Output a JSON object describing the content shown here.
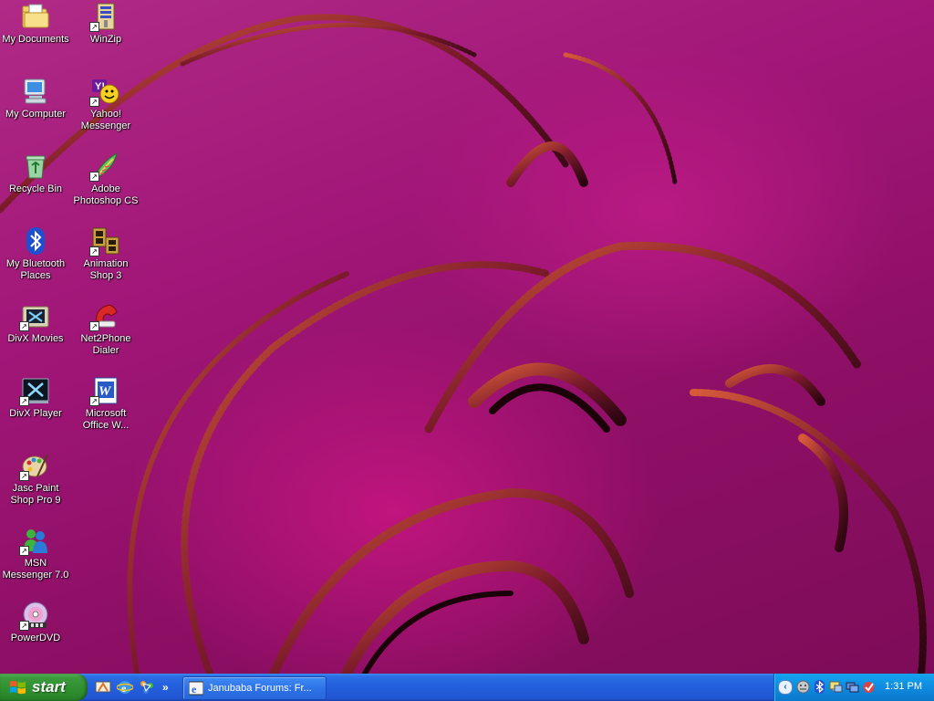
{
  "desktop": {
    "icons_left": [
      {
        "label": "My Documents",
        "icon": "folder-documents-icon"
      },
      {
        "label": "My Computer",
        "icon": "computer-icon"
      },
      {
        "label": "Recycle Bin",
        "icon": "recycle-bin-icon"
      },
      {
        "label": "My Bluetooth Places",
        "icon": "bluetooth-icon"
      },
      {
        "label": "DivX Movies",
        "icon": "divx-movies-icon"
      },
      {
        "label": "DivX Player",
        "icon": "divx-player-icon"
      },
      {
        "label": "Jasc Paint Shop Pro 9",
        "icon": "paint-palette-icon"
      },
      {
        "label": "MSN Messenger 7.0",
        "icon": "msn-messenger-icon"
      },
      {
        "label": "PowerDVD",
        "icon": "dvd-disc-icon"
      }
    ],
    "icons_right": [
      {
        "label": "WinZip",
        "icon": "winzip-icon"
      },
      {
        "label": "Yahoo! Messenger",
        "icon": "yahoo-messenger-icon"
      },
      {
        "label": "Adobe Photoshop CS",
        "icon": "photoshop-feather-icon"
      },
      {
        "label": "Animation Shop 3",
        "icon": "film-strip-icon"
      },
      {
        "label": "Net2Phone Dialer",
        "icon": "phone-icon"
      },
      {
        "label": "Microsoft Office W...",
        "icon": "word-document-icon"
      }
    ]
  },
  "taskbar": {
    "start_label": "start",
    "quick_launch": [
      "show-desktop-icon",
      "internet-explorer-icon",
      "network-tool-icon"
    ],
    "quick_launch_more": "»",
    "task_item_label": "Janubaba Forums: Fr...",
    "tray_expand": "‹",
    "tray_icons": [
      "messenger-status-icon",
      "bluetooth-tray-icon",
      "network-monitor-icon",
      "display-icon",
      "security-icon"
    ],
    "clock": "1:31 PM"
  },
  "colors": {
    "wallpaper_magenta": "#a11678",
    "taskbar_blue": "#245edc",
    "start_green": "#2f8f2f",
    "tray_blue": "#0f8bdf"
  }
}
